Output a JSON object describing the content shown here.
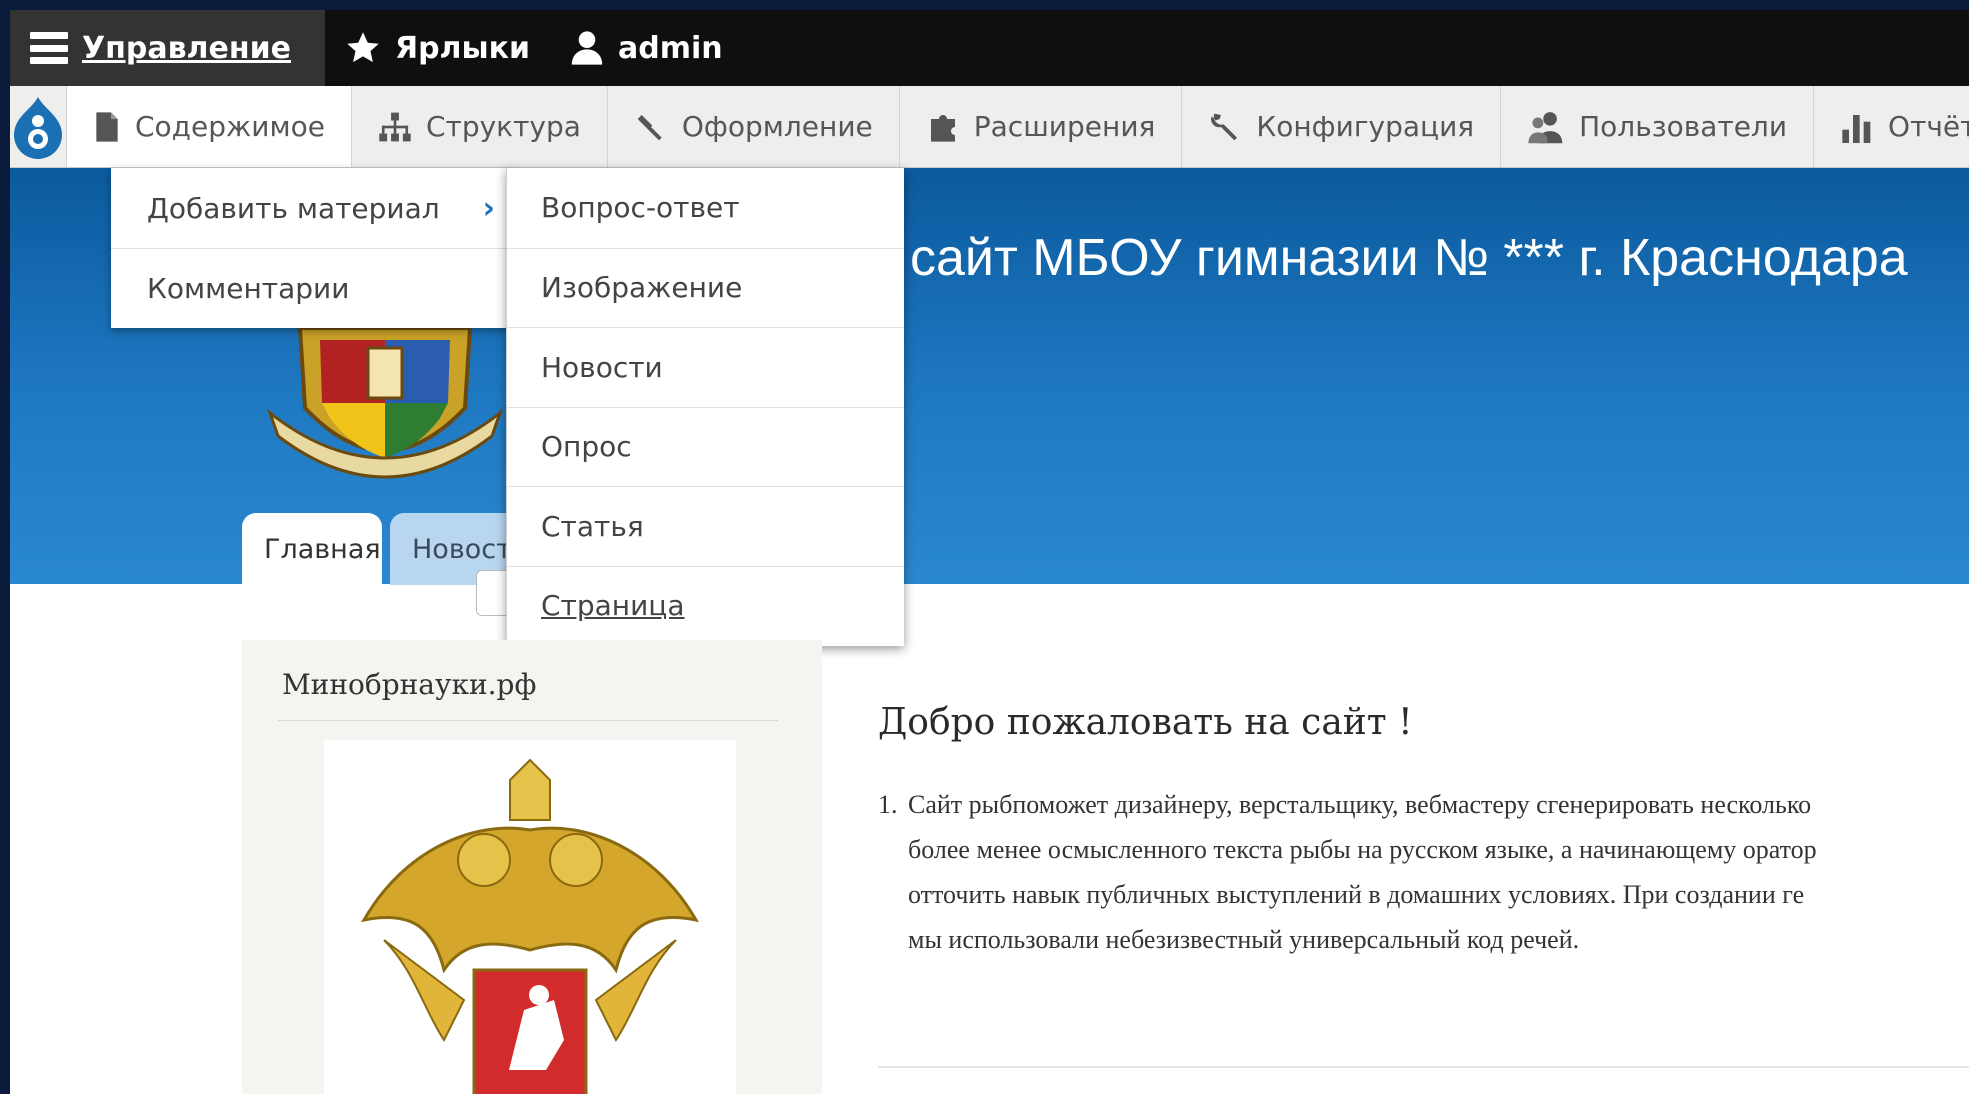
{
  "toolbar": {
    "manage_label": "Управление",
    "shortcuts_label": "Ярлыки",
    "user_label": "admin"
  },
  "tray": {
    "items": [
      {
        "label": "Содержимое",
        "icon": "file-icon"
      },
      {
        "label": "Структура",
        "icon": "sitemap-icon"
      },
      {
        "label": "Оформление",
        "icon": "brush-icon"
      },
      {
        "label": "Расширения",
        "icon": "puzzle-icon"
      },
      {
        "label": "Конфигурация",
        "icon": "wrench-icon"
      },
      {
        "label": "Пользователи",
        "icon": "users-icon"
      },
      {
        "label": "Отчёты",
        "icon": "bar-chart-icon"
      }
    ]
  },
  "content_menu": {
    "items": [
      "Добавить материал",
      "Комментарии"
    ]
  },
  "add_content_menu": {
    "items": [
      "Вопрос-ответ",
      "Изображение",
      "Новости",
      "Опрос",
      "Статья",
      "Страница"
    ]
  },
  "site": {
    "title": "сайт МБОУ гимназии № *** г. Краснодара",
    "tabs": [
      "Главная",
      "Новости"
    ]
  },
  "sidebar": {
    "title": "Минобрнауки.рф"
  },
  "main": {
    "heading": "Добро пожаловать на сайт !",
    "list_number": "1.",
    "list_lines": [
      "Сайт рыбпоможет дизайнеру, верстальщику, вебмастеру сгенерировать несколько",
      "более менее осмысленного текста рыбы на русском языке, а начинающему оратор",
      "отточить навык публичных выступлений в домашних условиях. При создании ге",
      "мы использовали небезизвестный универсальный код речей."
    ]
  },
  "colors": {
    "toolbar_bg": "#0f0f0f",
    "tray_bg": "#eeeeec",
    "header_blue": "#1f79c2",
    "drupal_blue": "#1b6fb3"
  }
}
